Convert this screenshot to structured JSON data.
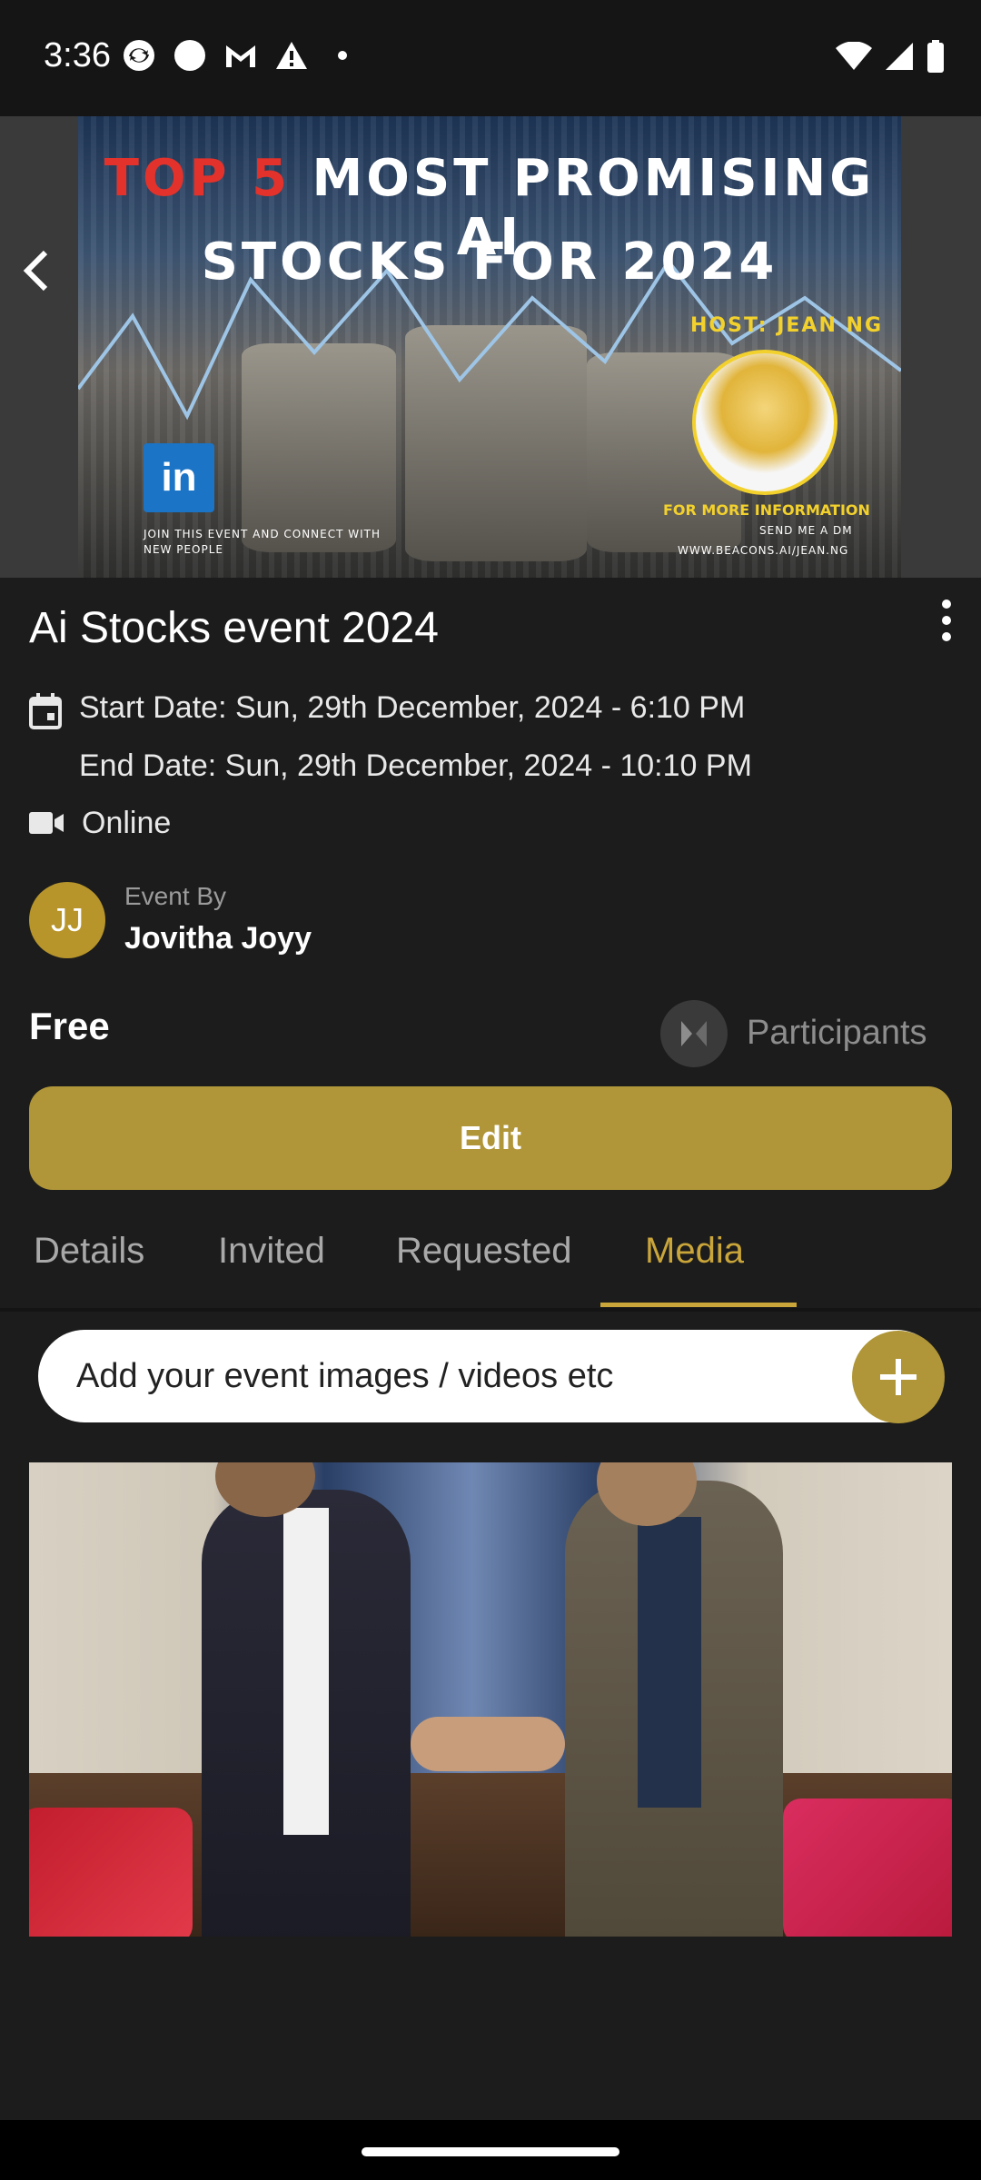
{
  "status_bar": {
    "time": "3:36",
    "left_icons": [
      "sync-icon",
      "circle-icon",
      "gmail-icon",
      "warning-icon",
      "dot-icon"
    ],
    "right_icons": [
      "wifi-icon",
      "signal-icon",
      "battery-icon"
    ]
  },
  "banner": {
    "title_red": "TOP 5",
    "title_line1_rest": " MOST PROMISING AI",
    "title_line2": "STOCKS FOR 2024",
    "host_label": "HOST: JEAN NG",
    "join_line1": "JOIN THIS EVENT AND CONNECT WITH",
    "join_line2": "NEW PEOPLE",
    "more_info": "FOR MORE INFORMATION",
    "send_dm": "SEND ME A DM",
    "website": "WWW.BEACONS.AI/JEAN.NG",
    "linkedin_text": "in"
  },
  "event": {
    "title": "Ai Stocks event 2024",
    "start_date": "Start Date: Sun, 29th December, 2024 - 6:10 PM",
    "end_date": "End Date: Sun, 29th December, 2024 - 10:10 PM",
    "location": "Online",
    "event_by_label": "Event By",
    "host_initials": "JJ",
    "host_name": "Jovitha Joyy",
    "price": "Free",
    "participants_label": "Participants",
    "edit_label": "Edit"
  },
  "tabs": [
    {
      "label": "Details",
      "active": false
    },
    {
      "label": "Invited",
      "active": false
    },
    {
      "label": "Requested",
      "active": false
    },
    {
      "label": "Media",
      "active": true
    }
  ],
  "media": {
    "add_placeholder": "Add your event images / videos etc"
  },
  "colors": {
    "accent": "#b09638",
    "tab_active": "#c9a53a",
    "background": "#1c1c1c"
  }
}
